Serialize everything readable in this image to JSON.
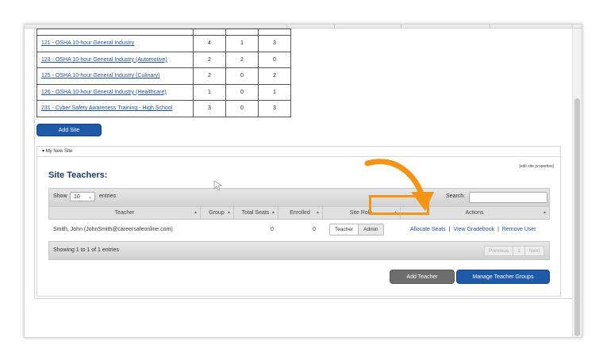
{
  "courses": {
    "rows": [
      {
        "name": "121 - OSHA 10-hour General Industry",
        "c1": "4",
        "c2": "1",
        "c3": "3"
      },
      {
        "name": "123 - OSHA 10-hour General Industry (Automotive)",
        "c1": "2",
        "c2": "2",
        "c3": "0"
      },
      {
        "name": "125 - OSHA 10-hour General Industry (Culinary)",
        "c1": "2",
        "c2": "0",
        "c3": "2"
      },
      {
        "name": "126 - OSHA 10-hour General Industry (Healthcare)",
        "c1": "1",
        "c2": "0",
        "c3": "1"
      },
      {
        "name": "231 - Cyber Safety Awareness Training - High School",
        "c1": "3",
        "c2": "0",
        "c3": "3"
      }
    ]
  },
  "add_site_label": "Add Site",
  "site": {
    "header": "My New Site",
    "edit_link": "[edit site properties]",
    "section_title": "Site Teachers:"
  },
  "datatable": {
    "show_label": "Show",
    "page_length": "10",
    "entries_label": "entries",
    "search_label": "Search:",
    "columns": [
      "Teacher",
      "Group",
      "Total Seats",
      "Enrolled",
      "Site Role",
      "Actions"
    ],
    "rows": [
      {
        "teacher": "Smith, John (JohnSmith@careersafeonline.com)",
        "group": "",
        "total_seats": "0",
        "enrolled": "0",
        "role_teacher": "Teacher",
        "role_admin": "Admin",
        "action_allocate": "Allocate Seats",
        "action_gradebook": "View Gradebook",
        "action_remove": "Remove User",
        "separator": "|"
      }
    ],
    "info": "Showing 1 to 1 of 1 entries",
    "pager": {
      "previous": "Previous",
      "page": "1",
      "next": "Next"
    }
  },
  "buttons": {
    "add_teacher": "Add Teacher",
    "manage_groups": "Manage Teacher Groups"
  },
  "colors": {
    "accent_blue": "#1e5aa8",
    "highlight_orange": "#f39417",
    "link_blue": "#1f4e9a"
  },
  "icons": {
    "collapse": "triangle-down-icon",
    "sort": "sort-arrow-icon",
    "select": "chevron-down-icon",
    "pointer": "mouse-cursor-icon",
    "annotation": "curved-arrow-icon"
  }
}
